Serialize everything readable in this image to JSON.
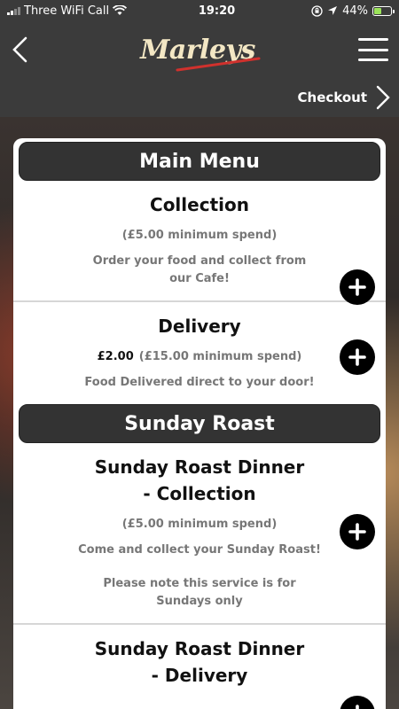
{
  "status_bar": {
    "carrier": "Three WiFi Call",
    "time": "19:20",
    "battery": "44%",
    "battery_level": 0.44
  },
  "header": {
    "logo_text": "Marleys"
  },
  "checkout": {
    "label": "Checkout"
  },
  "sections": [
    {
      "title": "Main Menu",
      "items": [
        {
          "title_lines": [
            "Collection"
          ],
          "price": "",
          "min_spend": "(£5.00 minimum spend)",
          "desc_lines": [
            "Order your food and collect from",
            "our Cafe!"
          ]
        },
        {
          "title_lines": [
            "Delivery"
          ],
          "price": "£2.00",
          "min_spend": "(£15.00 minimum spend)",
          "desc_lines": [
            "Food Delivered direct to your door!"
          ]
        }
      ]
    },
    {
      "title": "Sunday Roast",
      "items": [
        {
          "title_lines": [
            "Sunday Roast Dinner",
            "- Collection"
          ],
          "price": "",
          "min_spend": "(£5.00 minimum spend)",
          "desc_lines": [
            "Come and collect your Sunday Roast!"
          ],
          "note_lines": [
            "Please note this service is for",
            "Sundays only"
          ]
        },
        {
          "title_lines": [
            "Sunday Roast Dinner",
            "- Delivery"
          ]
        }
      ]
    }
  ],
  "colors": {
    "header_bg": "#3b3b3b",
    "section_bg": "#333333",
    "accent_red": "#d0312d",
    "button_black": "#000000"
  }
}
